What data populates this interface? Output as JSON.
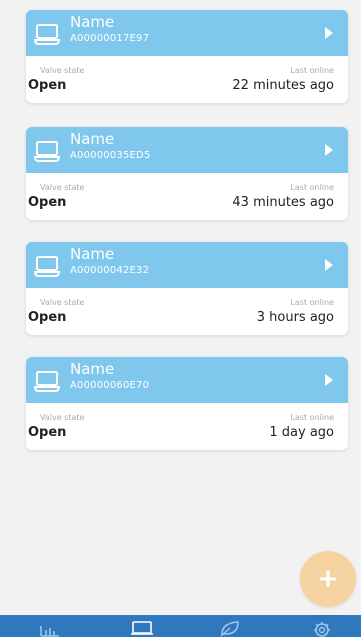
{
  "devices": [
    {
      "name": "Name",
      "id": "A00000017E97",
      "valve_label": "Valve state",
      "valve_value": "Open",
      "online_label": "Last online",
      "online_value": "22 minutes ago"
    },
    {
      "name": "Name",
      "id": "A00000035ED5",
      "valve_label": "Valve state",
      "valve_value": "Open",
      "online_label": "Last online",
      "online_value": "43 minutes ago"
    },
    {
      "name": "Name",
      "id": "A00000042E32",
      "valve_label": "Valve state",
      "valve_value": "Open",
      "online_label": "Last online",
      "online_value": "3 hours ago"
    },
    {
      "name": "Name",
      "id": "A00000060E70",
      "valve_label": "Valve state",
      "valve_value": "Open",
      "online_label": "Last online",
      "online_value": "1 day ago"
    }
  ],
  "fab": {
    "label": "+",
    "icon": "plus-icon"
  },
  "tabbar": {
    "icons": [
      "chart-icon",
      "device-icon",
      "leaf-icon",
      "settings-icon"
    ]
  },
  "colors": {
    "header_blue": "#7fc7ec",
    "tabbar_blue": "#2f78be",
    "fab_orange": "#f5d3a1",
    "background": "#f2f2f2"
  }
}
